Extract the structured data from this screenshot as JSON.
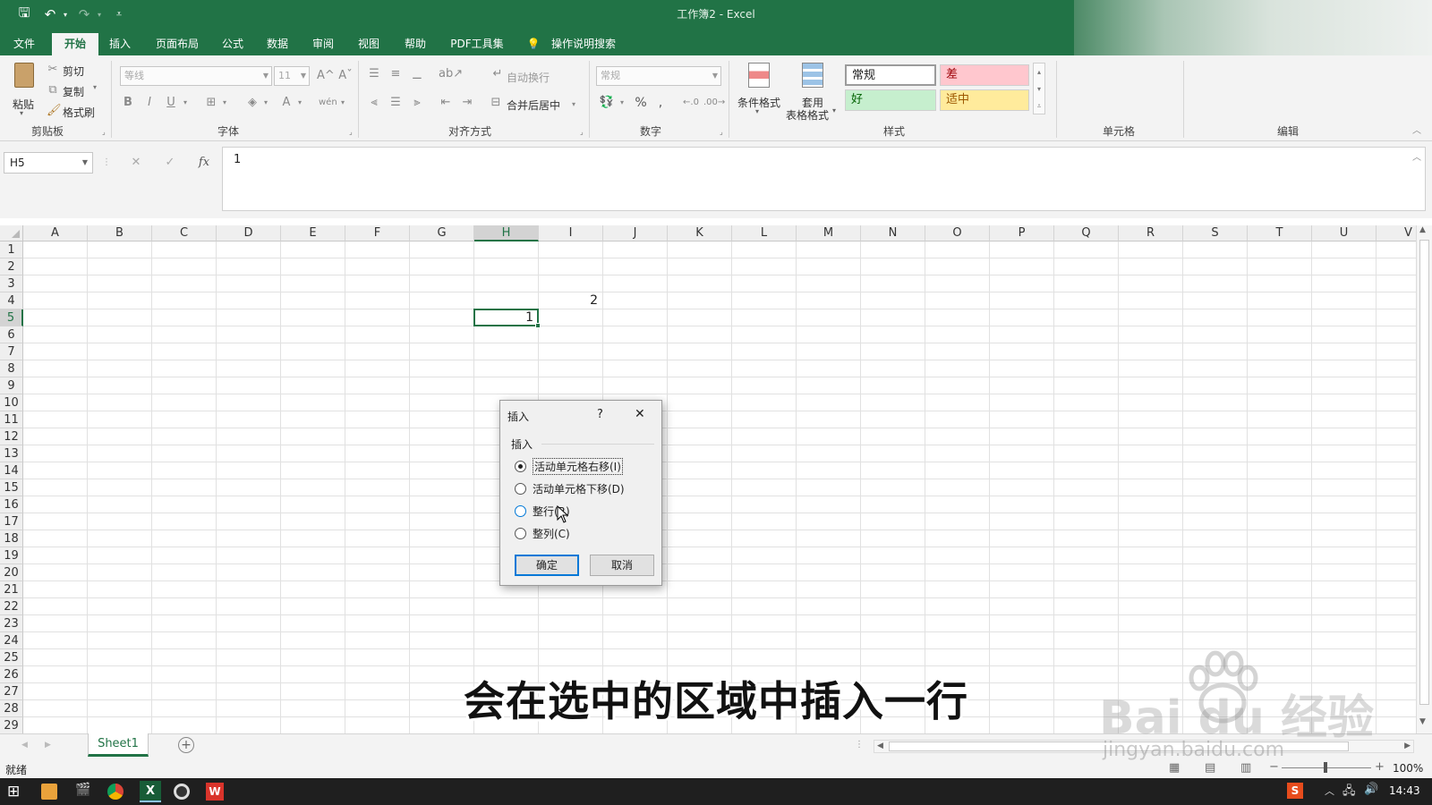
{
  "window": {
    "title": "工作簿2  -  Excel"
  },
  "quick_access": {
    "icons": [
      "save-icon",
      "undo-icon",
      "redo-icon",
      "customize-icon"
    ],
    "undo_glyph": "↶",
    "redo_glyph": "↷",
    "save_glyph": "🖫",
    "customize_glyph": "⩡"
  },
  "ribbon_tabs": [
    "文件",
    "开始",
    "插入",
    "页面布局",
    "公式",
    "数据",
    "审阅",
    "视图",
    "帮助",
    "PDF工具集",
    "操作说明搜索"
  ],
  "active_tab": "开始",
  "clipboard": {
    "paste": "粘贴",
    "cut": "剪切",
    "copy": "复制",
    "format_painter": "格式刷",
    "group": "剪贴板"
  },
  "font": {
    "name": "等线",
    "size": "11",
    "group": "字体",
    "bold": "B",
    "italic": "I",
    "underline": "U",
    "grow": "A^",
    "shrink": "Aˇ",
    "color": "A",
    "phonetic": "wén"
  },
  "alignment": {
    "wrap": "自动换行",
    "merge": "合并后居中",
    "group": "对齐方式"
  },
  "number": {
    "format": "常规",
    "percent": "%",
    "comma": ",",
    "group": "数字"
  },
  "styles": {
    "conditional": "条件格式",
    "table_format_1": "套用",
    "table_format_2": "表格格式",
    "normal": "常规",
    "bad": "差",
    "good": "好",
    "neutral": "适中",
    "group": "样式"
  },
  "cells_group": "单元格",
  "editing_group": "编辑",
  "colors": {
    "excel_green": "#217346",
    "bad_bg": "#ffc7ce",
    "bad_fg": "#9c0006",
    "good_bg": "#c6efce",
    "good_fg": "#006100",
    "neutral_bg": "#ffeb9c",
    "neutral_fg": "#9c5700",
    "dialog_accent": "#0078d7"
  },
  "formula_bar": {
    "name_box": "H5",
    "fx": "fx",
    "cancel": "✕",
    "enter": "✓",
    "value": "1"
  },
  "grid": {
    "columns": [
      "A",
      "B",
      "C",
      "D",
      "E",
      "F",
      "G",
      "H",
      "I",
      "J",
      "K",
      "L",
      "M",
      "N",
      "O",
      "P",
      "Q",
      "R",
      "S",
      "T",
      "U",
      "V"
    ],
    "rows": [
      "1",
      "2",
      "3",
      "4",
      "5",
      "6",
      "7",
      "8",
      "9",
      "10",
      "11",
      "12",
      "13",
      "14",
      "15",
      "16",
      "17",
      "18",
      "19",
      "20",
      "21",
      "22",
      "23",
      "24",
      "25",
      "26",
      "27",
      "28",
      "29"
    ],
    "selected_column": "H",
    "selected_row": "5",
    "cells": [
      {
        "ref": "H5",
        "value": "1"
      },
      {
        "ref": "I4",
        "value": "2"
      }
    ]
  },
  "dialog": {
    "title": "插入",
    "help": "?",
    "close": "✕",
    "section": "插入",
    "options": [
      {
        "label": "活动单元格右移(I)",
        "selected": true
      },
      {
        "label": "活动单元格下移(D)",
        "selected": false
      },
      {
        "label": "整行(R)",
        "selected": false
      },
      {
        "label": "整列(C)",
        "selected": false
      }
    ],
    "ok": "确定",
    "cancel": "取消"
  },
  "sheet_tabs": [
    "Sheet1"
  ],
  "status": {
    "ready": "就绪",
    "zoom": "100%",
    "zoom_minus": "−",
    "zoom_plus": "+"
  },
  "taskbar": {
    "time": "14:43"
  },
  "subtitle": "会在选中的区域中插入一行",
  "watermark": {
    "brand": "Bai du 经验",
    "url": "jingyan.baidu.com"
  }
}
